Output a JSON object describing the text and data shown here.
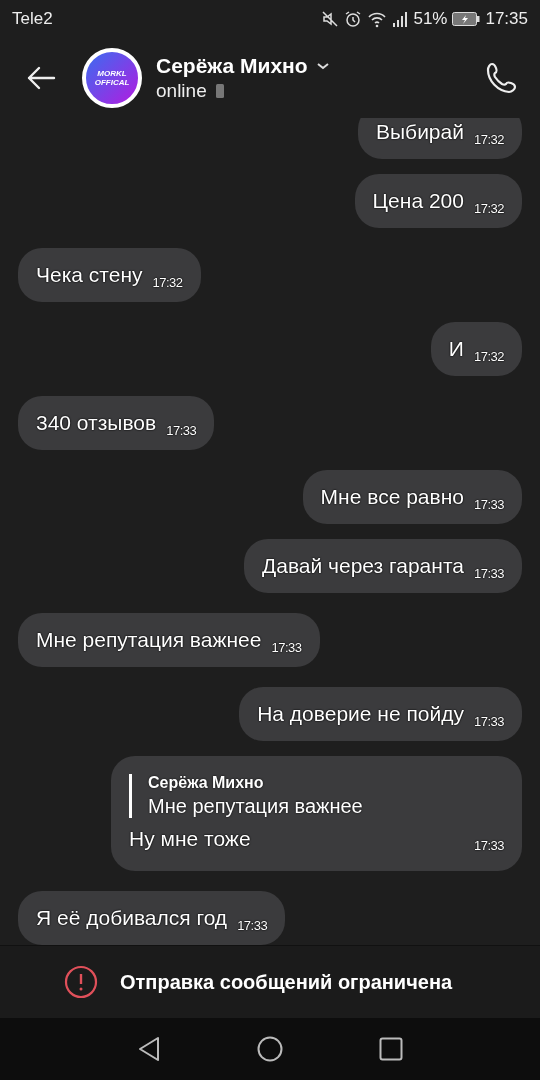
{
  "status_bar": {
    "carrier": "Tele2",
    "battery": "51%",
    "time": "17:35"
  },
  "header": {
    "avatar_text": [
      "MORKL",
      "OFFICAL"
    ],
    "name": "Серёжа Михно",
    "status": "online"
  },
  "messages": [
    {
      "kind": "text",
      "outgoing": true,
      "text": "Выбирай",
      "time": "17:32"
    },
    {
      "kind": "text",
      "outgoing": true,
      "text": "Цена 200",
      "time": "17:32"
    },
    {
      "kind": "text",
      "outgoing": false,
      "text": "Чека стену",
      "time": "17:32"
    },
    {
      "kind": "text",
      "outgoing": true,
      "text": "И",
      "time": "17:32"
    },
    {
      "kind": "text",
      "outgoing": false,
      "text": "340 отзывов",
      "time": "17:33"
    },
    {
      "kind": "text",
      "outgoing": true,
      "text": "Мне все равно",
      "time": "17:33"
    },
    {
      "kind": "text",
      "outgoing": true,
      "text": "Давай через гаранта",
      "time": "17:33"
    },
    {
      "kind": "text",
      "outgoing": false,
      "text": "Мне репутация важнее",
      "time": "17:33"
    },
    {
      "kind": "text",
      "outgoing": true,
      "text": "На доверие не пойду",
      "time": "17:33"
    },
    {
      "kind": "reply",
      "outgoing": true,
      "quote_author": "Серёжа Михно",
      "quote_text": "Мне репутация важнее",
      "text": "Ну мне тоже",
      "time": "17:33"
    },
    {
      "kind": "text",
      "outgoing": false,
      "text": "Я её добивался год",
      "time": "17:33"
    }
  ],
  "restriction_notice": "Отправка сообщений ограничена"
}
